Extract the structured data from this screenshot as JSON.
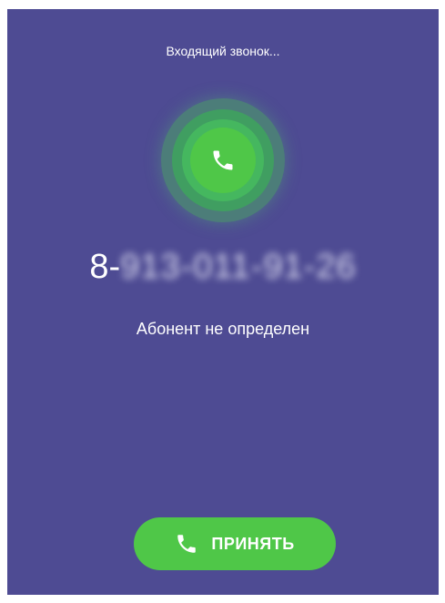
{
  "call": {
    "status": "Входящий звонок...",
    "number_prefix": "8-",
    "number_masked": "913-011-91-26",
    "caller_name": "Абонент не определен"
  },
  "accept_button": {
    "label": "ПРИНЯТЬ",
    "icon": "phone-icon"
  },
  "colors": {
    "background": "#4e4b93",
    "accent_green": "#4fc748",
    "text": "#ffffff"
  }
}
